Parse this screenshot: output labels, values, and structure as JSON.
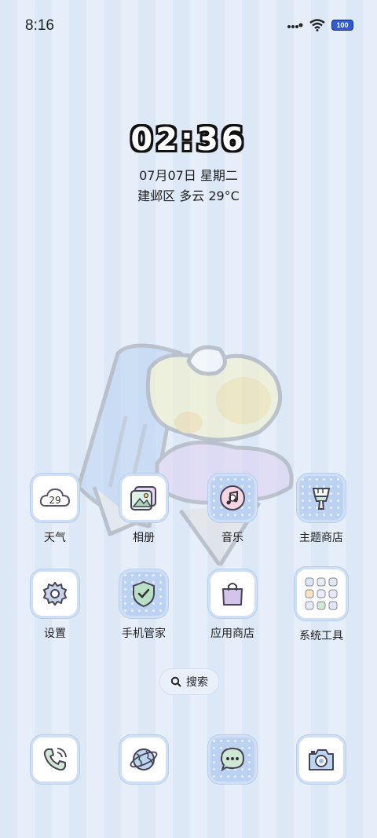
{
  "status": {
    "time": "8:16",
    "battery": "100"
  },
  "lockclock": {
    "time": "02:36",
    "date": "07月07日 星期二",
    "weather": "建邺区 多云 29°C"
  },
  "apps_row1": [
    {
      "label": "天气",
      "icon": "weather-icon",
      "badge": "29"
    },
    {
      "label": "相册",
      "icon": "gallery-icon"
    },
    {
      "label": "音乐",
      "icon": "music-icon"
    },
    {
      "label": "主题商店",
      "icon": "theme-store-icon"
    }
  ],
  "apps_row2": [
    {
      "label": "设置",
      "icon": "settings-icon"
    },
    {
      "label": "手机管家",
      "icon": "security-icon"
    },
    {
      "label": "应用商店",
      "icon": "app-store-icon"
    },
    {
      "label": "系统工具",
      "icon": "system-tools-folder-icon"
    }
  ],
  "search": {
    "label": "搜索",
    "icon": "search-icon"
  },
  "dock": [
    {
      "icon": "phone-icon"
    },
    {
      "icon": "browser-icon"
    },
    {
      "icon": "messages-icon"
    },
    {
      "icon": "camera-icon"
    }
  ]
}
